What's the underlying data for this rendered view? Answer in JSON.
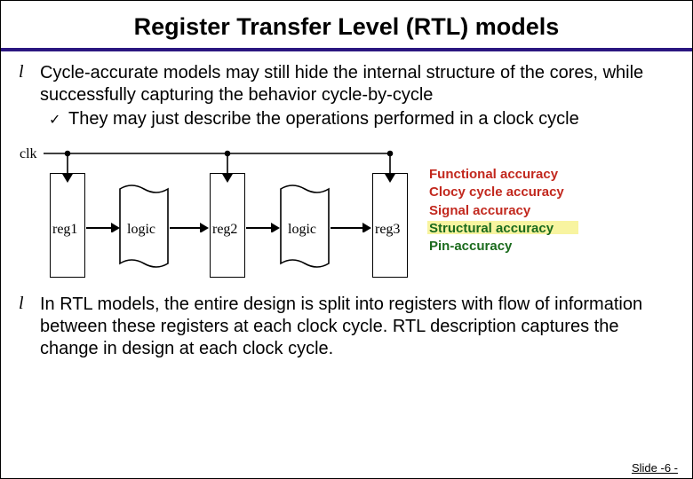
{
  "title": "Register Transfer Level (RTL) models",
  "bullets": {
    "b1": "Cycle-accurate models may still hide the internal structure of the cores, while successfully capturing the behavior cycle-by-cycle",
    "b1_sub": "They may just describe the operations performed in a clock cycle",
    "b2": "In RTL models, the entire design is split into registers with flow of information between these registers at each clock cycle. RTL description captures the change in design at each clock cycle."
  },
  "diagram": {
    "clk": "clk",
    "reg1": "reg1",
    "reg2": "reg2",
    "reg3": "reg3",
    "logic1": "logic",
    "logic2": "logic"
  },
  "accuracy": {
    "a1": "Functional accuracy",
    "a2": "Clocy cycle accuracy",
    "a3": "Signal accuracy",
    "a4": "Structural accuracy",
    "a5": "Pin-accuracy"
  },
  "footer": "Slide -6 -"
}
